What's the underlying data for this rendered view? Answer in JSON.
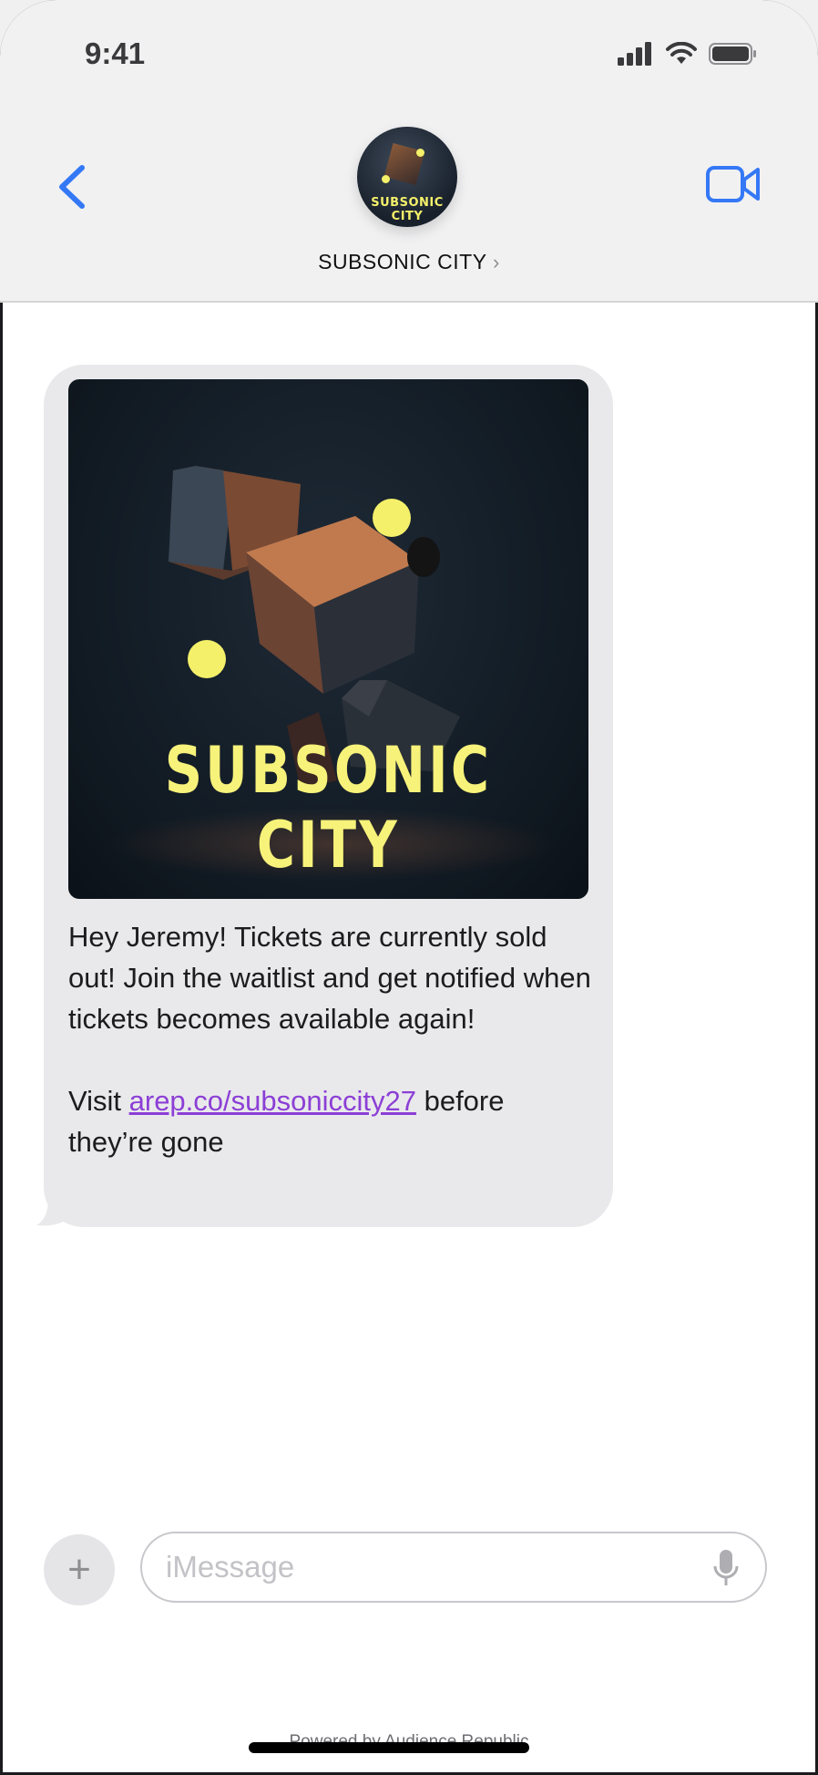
{
  "status_bar": {
    "time": "9:41",
    "icons": [
      "signal-icon",
      "wifi-icon",
      "battery-icon"
    ]
  },
  "header": {
    "contact_name": "SUBSONIC CITY",
    "chevron": "›",
    "avatar_text": "SUBSONIC CITY",
    "back_icon": "chevron-left-icon",
    "video_icon": "video-camera-icon"
  },
  "message": {
    "image_title": "SUBSONIC CITY",
    "paragraph1": "Hey Jeremy! Tickets are currently sold out! Join the waitlist and get notified when tickets becomes available again!",
    "visit_prefix": "Visit ",
    "link_text": "arep.co/subsoniccity27",
    "visit_suffix": " before they’re gone"
  },
  "composer": {
    "plus_label": "+",
    "placeholder": "iMessage",
    "mic_icon": "microphone-icon"
  },
  "footer": {
    "powered_by": "Powered by Audience Republic"
  },
  "colors": {
    "accent_blue": "#3478f6",
    "link_purple": "#8c3fd6",
    "bubble_gray": "#e9e9eb",
    "title_yellow": "#f7f27a"
  }
}
